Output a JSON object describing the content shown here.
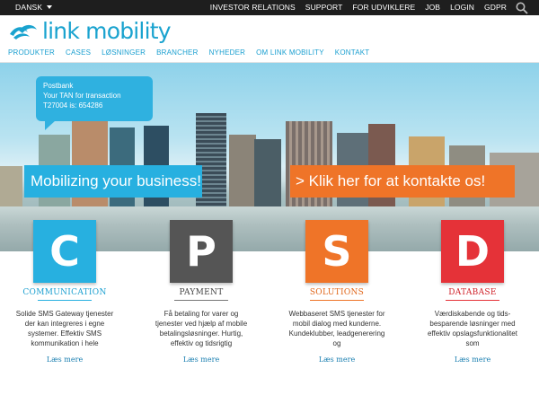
{
  "topbar": {
    "language": "DANSK",
    "links": [
      "INVESTOR RELATIONS",
      "SUPPORT",
      "FOR UDVIKLERE",
      "JOB",
      "LOGIN",
      "GDPR"
    ]
  },
  "logo": {
    "text": "link mobility"
  },
  "nav": {
    "items": [
      "PRODUKTER",
      "CASES",
      "LØSNINGER",
      "BRANCHER",
      "NYHEDER",
      "OM LINK MOBILITY",
      "KONTAKT"
    ]
  },
  "hero": {
    "bubble": {
      "line1": "Postbank",
      "line2": "Your TAN for transaction",
      "line3": "T27004 is: 654286"
    },
    "banner_left": "Mobilizing your business!",
    "banner_right": "> Klik her for at kontakte os!"
  },
  "colors": {
    "blue": "#27b0e0",
    "dark": "#555555",
    "orange": "#ef7428",
    "red": "#e53238"
  },
  "cards": [
    {
      "letter": "C",
      "title": "COMMUNICATION",
      "desc": "Solide SMS Gateway tjenester der kan integreres i egne systemer. Effektiv SMS kommunikation i hele",
      "more": "Læs mere"
    },
    {
      "letter": "P",
      "title": "PAYMENT",
      "desc": "Få betaling for varer og tjenester ved hjælp af mobile betalingsløsninger. Hurtig, effektiv og tidsrigtig",
      "more": "Læs mere"
    },
    {
      "letter": "S",
      "title": "SOLUTIONS",
      "desc": "Webbaseret SMS tjenester for mobil dialog med kunderne. Kundeklubber, leadgenerering og",
      "more": "Læs mere"
    },
    {
      "letter": "D",
      "title": "DATABASE",
      "desc": "Værdiskabende og tids-besparende løsninger med effektiv opslagsfunktionalitet som",
      "more": "Læs mere"
    }
  ]
}
